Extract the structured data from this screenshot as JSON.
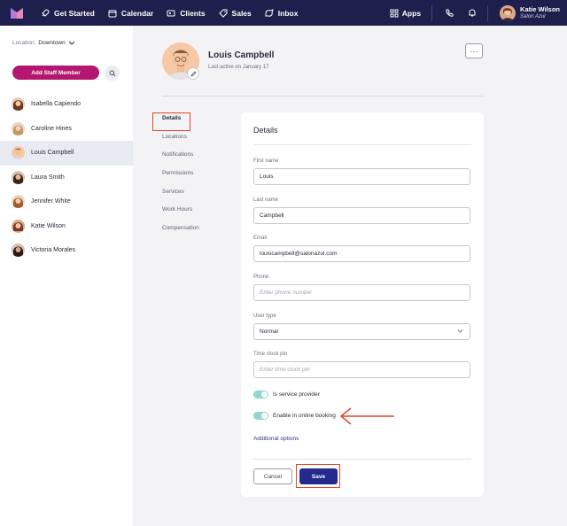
{
  "topnav": {
    "items": [
      {
        "label": "Get Started",
        "icon": "rocket-icon"
      },
      {
        "label": "Calendar",
        "icon": "calendar-icon"
      },
      {
        "label": "Clients",
        "icon": "clients-icon"
      },
      {
        "label": "Sales",
        "icon": "tag-icon"
      },
      {
        "label": "Inbox",
        "icon": "inbox-icon"
      }
    ],
    "apps_label": "Apps",
    "user_name": "Katie Wilson",
    "user_sub": "Salon Azul"
  },
  "sidebar": {
    "location_label": "Location:",
    "location_value": "Downtown",
    "add_staff_label": "Add Staff Member",
    "staff": [
      {
        "name": "Isabella Capiendo"
      },
      {
        "name": "Caroline Hines"
      },
      {
        "name": "Louis Campbell"
      },
      {
        "name": "Laura Smith"
      },
      {
        "name": "Jennifer White"
      },
      {
        "name": "Katie Wilson"
      },
      {
        "name": "Victoria Morales"
      }
    ],
    "active_staff": "Louis Campbell"
  },
  "profile": {
    "name": "Louis Campbell",
    "last_active": "Last active on January 17",
    "more_label": "···"
  },
  "subnav": {
    "items": [
      {
        "label": "Details"
      },
      {
        "label": "Locations"
      },
      {
        "label": "Notifications"
      },
      {
        "label": "Permissions"
      },
      {
        "label": "Services"
      },
      {
        "label": "Work Hours"
      },
      {
        "label": "Compensation"
      }
    ],
    "active": "Details"
  },
  "form": {
    "title": "Details",
    "first_name": {
      "label": "First name",
      "value": "Louis"
    },
    "last_name": {
      "label": "Last name",
      "value": "Campbell"
    },
    "email": {
      "label": "Email",
      "value": "louiscampbell@salonazul.com"
    },
    "phone": {
      "label": "Phone",
      "placeholder": "Enter phone number"
    },
    "user_type": {
      "label": "User type",
      "value": "Normal"
    },
    "time_clock": {
      "label": "Time clock pin",
      "placeholder": "Enter time clock pin"
    },
    "service_provider_label": "Is service provider",
    "online_booking_label": "Enable in online booking",
    "additional_options": "Additional options",
    "cancel_label": "Cancel",
    "save_label": "Save"
  },
  "colors": {
    "nav_bg": "#1f1f4d",
    "brand_pink": "#b4176f",
    "primary_blue": "#232a8c",
    "toggle_on": "#8fd5d1",
    "highlight_red": "#e4452b"
  }
}
